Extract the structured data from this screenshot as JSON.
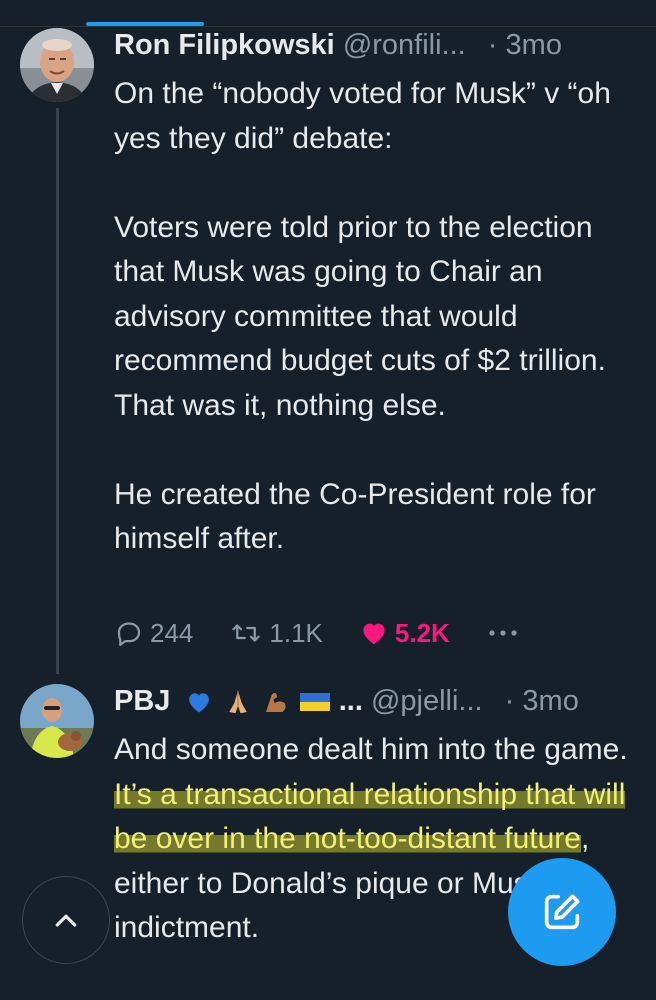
{
  "tweets": [
    {
      "author_name": "Ron Filipkowski",
      "handle": "@ronfili...",
      "separator": "·",
      "time": "3mo",
      "body": "On the “nobody voted for Musk” v “oh yes they did” debate:\n\nVoters were told prior to the election that Musk was going to Chair an advisory committee that would recommend budget cuts of $2 trillion. That was it, nothing else.\n\nHe created the Co-President role for himself after.",
      "replies": "244",
      "retweets": "1.1K",
      "likes": "5.2K",
      "more_icon": "more-dots-icon",
      "like_color": "#f91880"
    },
    {
      "author_name": "PBJ",
      "name_emojis": [
        "blue-heart",
        "folded-hands",
        "flexed-biceps",
        "ukraine-flag"
      ],
      "name_ellipsis": "...",
      "handle": "@pjelli...",
      "separator": "·",
      "time": "3mo",
      "body_plain_1": "And someone dealt him into the game. ",
      "body_highlighted": "It’s a transactional relationship that will be over in the not-too-distant future",
      "body_plain_2": ", either to Donald’s pique or Muskrat’s indictment.",
      "highlight_color": "#c4c428"
    }
  ],
  "floating_buttons": {
    "scroll_top_icon": "chevron-up-icon",
    "compose_icon": "compose-icon",
    "compose_color": "#1d9bf0"
  },
  "theme": {
    "background": "#15202b",
    "text": "#e7e9ea",
    "muted": "#8b98a5",
    "accent": "#1d9bf0"
  }
}
